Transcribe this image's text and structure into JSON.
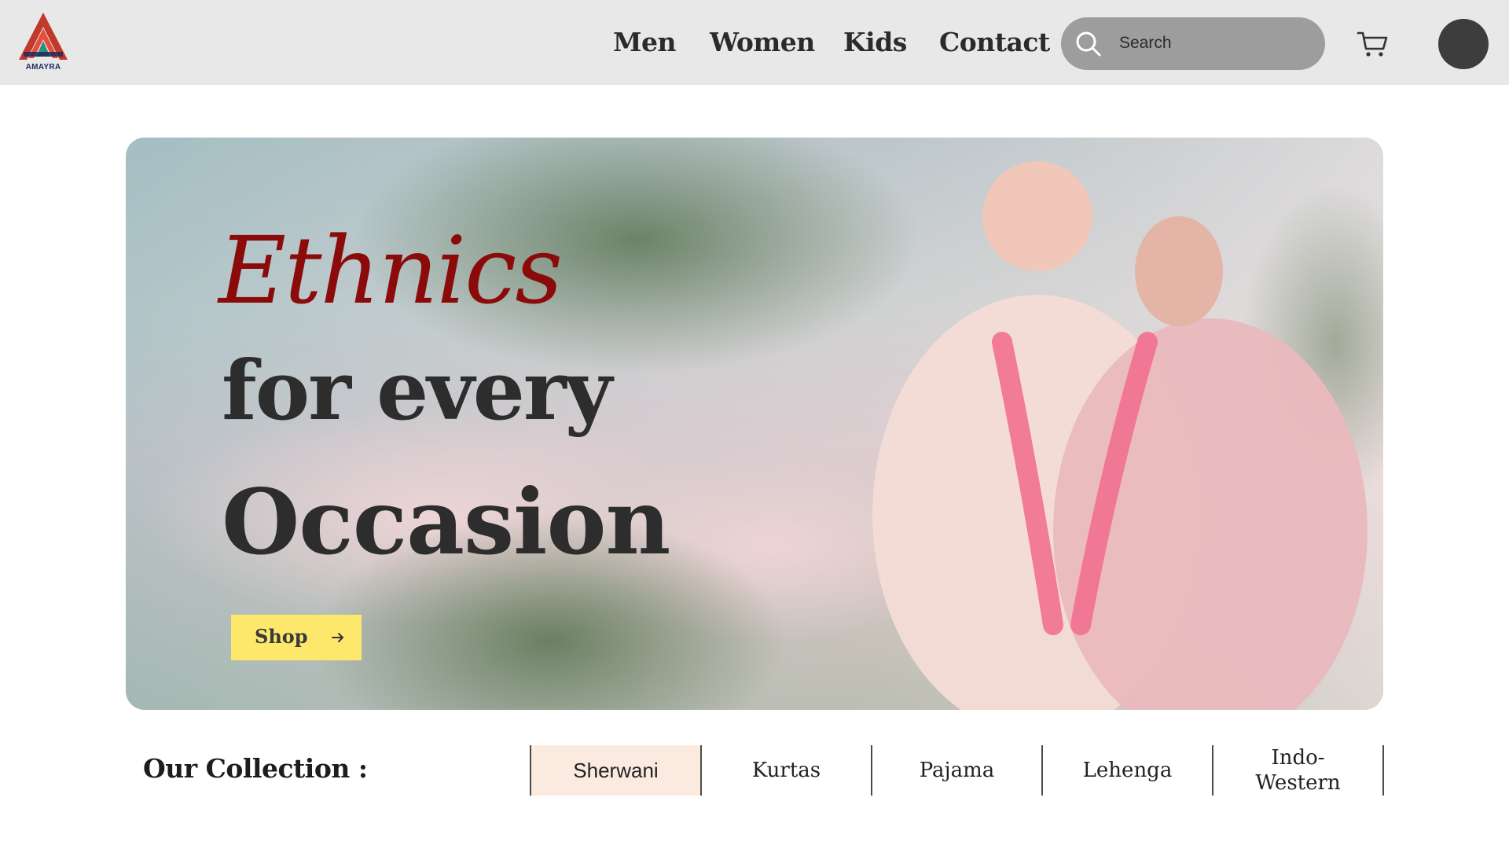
{
  "brand": {
    "name": "AMAYRA",
    "colors": {
      "red": "#c0392b",
      "navy": "#1c2a5c",
      "teal": "#2f8f7a"
    }
  },
  "nav": {
    "items": [
      {
        "label": "Men"
      },
      {
        "label": "Women"
      },
      {
        "label": "Kids"
      },
      {
        "label": "Contact"
      }
    ]
  },
  "search": {
    "placeholder": "Search",
    "icon": "search-icon"
  },
  "header_icons": {
    "cart": "cart-icon",
    "avatar": "user-avatar"
  },
  "hero": {
    "headline_script": "Ethnics",
    "headline_line2": "for every",
    "headline_line3": "Occasion",
    "cta_label": "Shop",
    "cta_icon": "arrow-right-icon",
    "cta_color": "#fde86b",
    "script_color": "#8b0b0b"
  },
  "collection": {
    "title": "Our Collection :",
    "tabs": [
      {
        "label": "Sherwani",
        "active": true
      },
      {
        "label": "Kurtas",
        "active": false
      },
      {
        "label": "Pajama",
        "active": false
      },
      {
        "label": "Lehenga",
        "active": false
      },
      {
        "label": "Indo-\nWestern",
        "active": false
      }
    ],
    "active_color": "#fbeae0"
  }
}
